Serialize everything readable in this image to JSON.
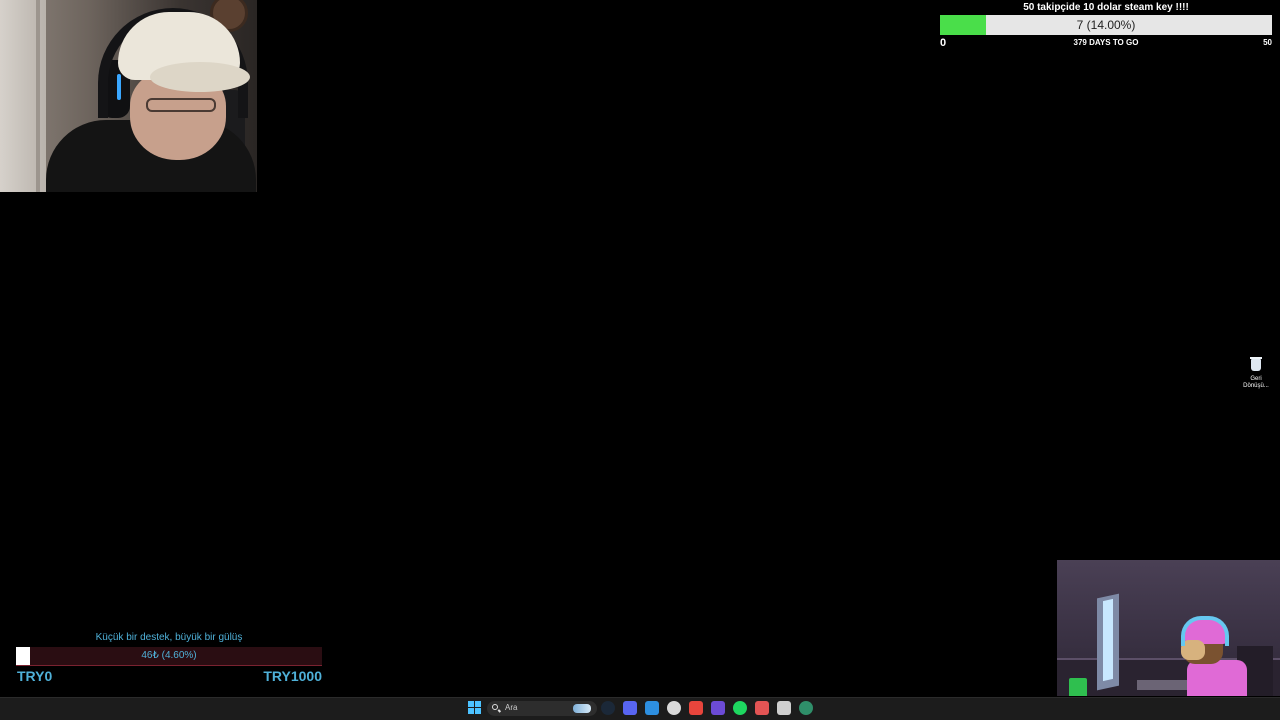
{
  "follower_goal": {
    "title": "50 takipçide 10 dolar steam key !!!!",
    "progress_text": "7 (14.00%)",
    "progress_fraction": 0.14,
    "min_label": "0",
    "days_text": "379 DAYS TO GO",
    "max_label": "50",
    "fill_color": "#4ade4a"
  },
  "desktop": {
    "recycle_bin_label_line1": "Geri",
    "recycle_bin_label_line2": "Dönüşü..."
  },
  "donation_goal": {
    "title": "Küçük bir destek, büyük bir gülüş",
    "progress_text": "46₺ (4.60%)",
    "progress_fraction": 0.046,
    "min_label": "TRY0",
    "max_label": "TRY1000",
    "accent_color": "#4fb1d9"
  },
  "taskbar": {
    "search_placeholder": "Ara",
    "pinned_apps": [
      {
        "icon": "steam-icon",
        "color": "#1b2838"
      },
      {
        "icon": "discord-icon",
        "color": "#5865f2"
      },
      {
        "icon": "vscode-icon",
        "color": "#2d8fe0"
      },
      {
        "icon": "file-explorer-icon",
        "color": "#d9d9d9"
      },
      {
        "icon": "chrome-icon",
        "color": "#e8453c"
      },
      {
        "icon": "vpn-icon",
        "color": "#6c4bd6"
      },
      {
        "icon": "spotify-icon",
        "color": "#1ed760"
      },
      {
        "icon": "obs-icon",
        "color": "#e35454"
      },
      {
        "icon": "battle-net-icon",
        "color": "#cfcfcf"
      },
      {
        "icon": "terminal-icon",
        "color": "#2f8f6a"
      }
    ]
  }
}
